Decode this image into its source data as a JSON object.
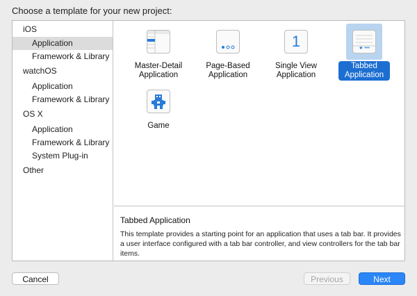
{
  "header": {
    "title": "Choose a template for your new project:"
  },
  "sidebar": {
    "items": [
      {
        "label": "iOS",
        "kind": "section"
      },
      {
        "label": "Application",
        "kind": "child",
        "selected": true
      },
      {
        "label": "Framework & Library",
        "kind": "child"
      },
      {
        "label": "watchOS",
        "kind": "section"
      },
      {
        "label": "Application",
        "kind": "child"
      },
      {
        "label": "Framework & Library",
        "kind": "child"
      },
      {
        "label": "OS X",
        "kind": "section"
      },
      {
        "label": "Application",
        "kind": "child"
      },
      {
        "label": "Framework & Library",
        "kind": "child"
      },
      {
        "label": "System Plug-in",
        "kind": "child"
      },
      {
        "label": "Other",
        "kind": "section"
      }
    ]
  },
  "templates": [
    {
      "label_line1": "Master-Detail",
      "label_line2": "Application",
      "icon": "master-detail-icon"
    },
    {
      "label_line1": "Page-Based",
      "label_line2": "Application",
      "icon": "page-based-icon"
    },
    {
      "label_line1": "Single View",
      "label_line2": "Application",
      "icon": "single-view-icon",
      "icon_text": "1"
    },
    {
      "label_line1": "Tabbed",
      "label_line2": "Application",
      "icon": "tabbed-icon",
      "selected": true,
      "icon_text": "★ •••"
    },
    {
      "label_line1": "Game",
      "label_line2": "",
      "icon": "game-icon"
    }
  ],
  "description": {
    "title": "Tabbed Application",
    "text": "This template provides a starting point for an application that uses a tab bar. It provides a user interface configured with a tab bar controller, and view controllers for the tab bar items."
  },
  "buttons": {
    "cancel": "Cancel",
    "previous": "Previous",
    "next": "Next"
  },
  "colors": {
    "selection": "#1c6ed1",
    "next_button": "#2b86f7",
    "icon_blue": "#2a7bd8"
  }
}
